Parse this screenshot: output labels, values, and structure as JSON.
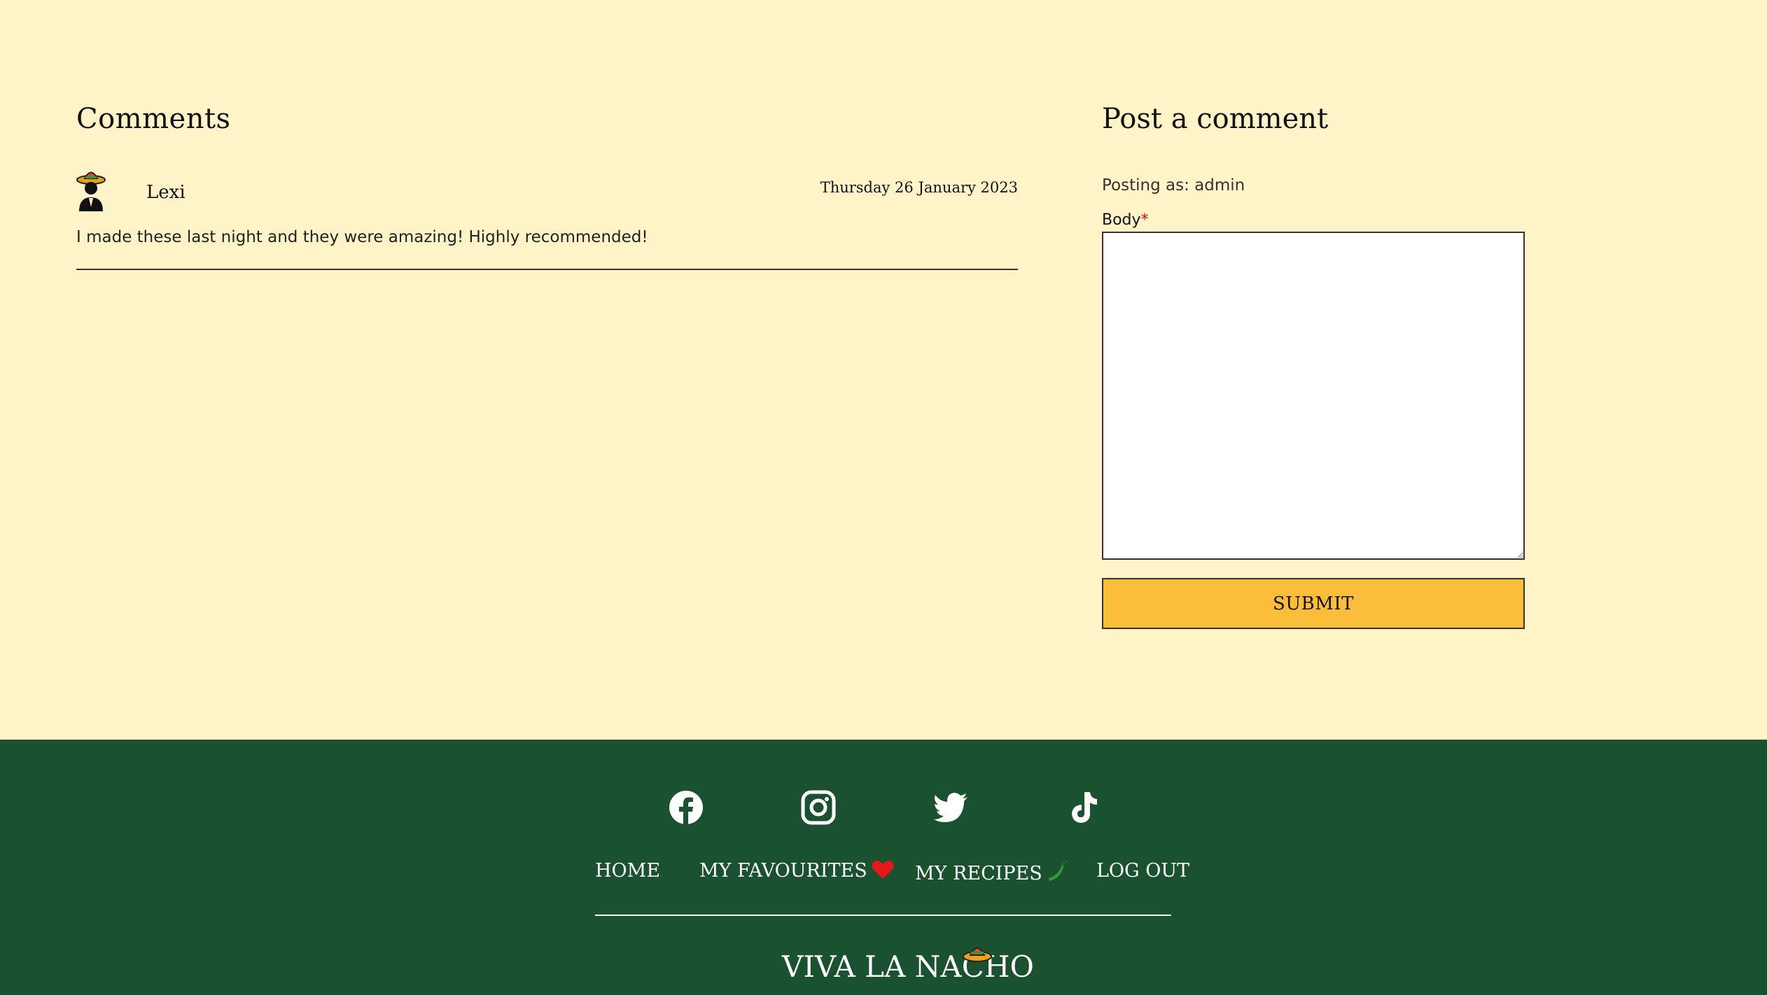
{
  "comments": {
    "heading": "Comments",
    "items": [
      {
        "avatar_icon": "sombrero-man-icon",
        "author": "Lexi",
        "date": "Thursday 26 January 2023",
        "body": "I made these last night and they were amazing! Highly recommended!"
      }
    ]
  },
  "post": {
    "heading": "Post a comment",
    "posting_as": "Posting as: admin",
    "body_label": "Body",
    "required_mark": "*",
    "body_value": "",
    "submit_label": "SUBMIT"
  },
  "footer": {
    "socials": [
      "facebook-icon",
      "instagram-icon",
      "twitter-icon",
      "tiktok-icon"
    ],
    "nav": {
      "home": "HOME",
      "favourites": "MY FAVOURITES",
      "favourites_icon": "heart-icon",
      "recipes": "MY RECIPES",
      "recipes_icon": "chilli-icon",
      "logout": "LOG OUT"
    },
    "brand": "VIVA LA NACHO",
    "brand_icon": "sombrero-icon"
  },
  "colors": {
    "background": "#fff3c8",
    "footer": "#1a5230",
    "submit": "#fbbe3b",
    "required": "#e0001b",
    "heart": "#e8161d",
    "chilli": "#2f9a3b"
  }
}
